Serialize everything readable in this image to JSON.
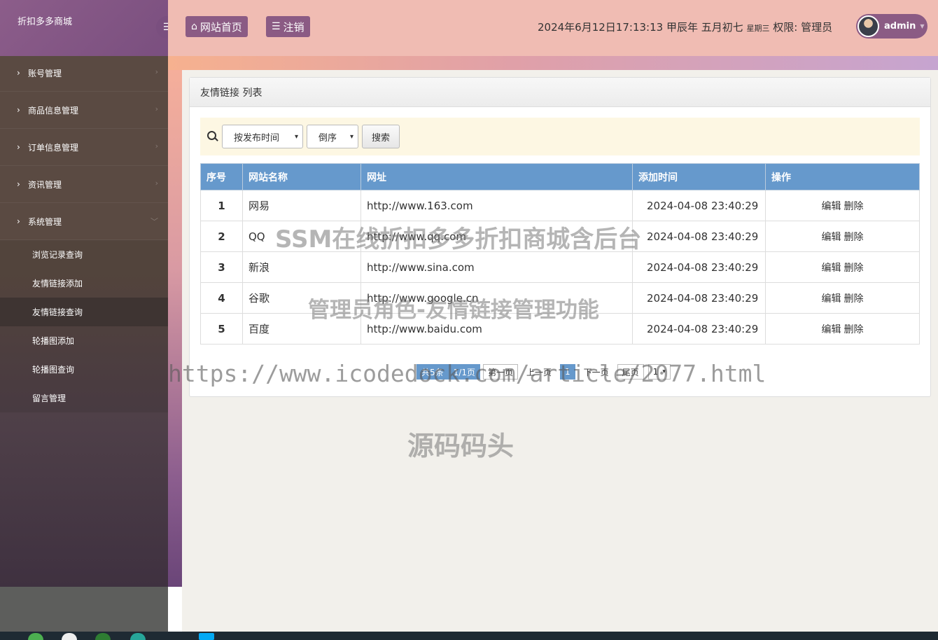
{
  "app": {
    "brand": "折扣多多商城",
    "toggle_icon": "hamburger-icon"
  },
  "header": {
    "home_label": "网站首页",
    "logout_label": "注销",
    "datetime": "2024年6月12日17:13:13 甲辰年 五月初七",
    "weekday": "星期三",
    "role_label": "权限: 管理员",
    "username": "admin"
  },
  "sidebar": {
    "items": [
      {
        "label": "账号管理"
      },
      {
        "label": "商品信息管理"
      },
      {
        "label": "订单信息管理"
      },
      {
        "label": "资讯管理"
      },
      {
        "label": "系统管理"
      }
    ],
    "sub_items": [
      {
        "label": "浏览记录查询"
      },
      {
        "label": "友情链接添加"
      },
      {
        "label": "友情链接查询"
      },
      {
        "label": "轮播图添加"
      },
      {
        "label": "轮播图查询"
      },
      {
        "label": "留言管理"
      }
    ]
  },
  "panel": {
    "title": "友情链接 列表"
  },
  "search": {
    "sort_field": "按发布时间",
    "sort_order": "倒序",
    "button_label": "搜索"
  },
  "table": {
    "headers": [
      "序号",
      "网站名称",
      "网址",
      "添加时间",
      "操作"
    ],
    "rows": [
      {
        "id": "1",
        "name": "网易",
        "url": "http://www.163.com",
        "time": "2024-04-08 23:40:29"
      },
      {
        "id": "2",
        "name": "QQ",
        "url": "http://www.qq.com",
        "time": "2024-04-08 23:40:29"
      },
      {
        "id": "3",
        "name": "新浪",
        "url": "http://www.sina.com",
        "time": "2024-04-08 23:40:29"
      },
      {
        "id": "4",
        "name": "谷歌",
        "url": "http://www.google.cn",
        "time": "2024-04-08 23:40:29"
      },
      {
        "id": "5",
        "name": "百度",
        "url": "http://www.baidu.com",
        "time": "2024-04-08 23:40:29"
      }
    ],
    "edit_label": "编辑",
    "delete_label": "删除"
  },
  "pager": {
    "total": "共5条",
    "pages": "1/1页",
    "first": "第一页",
    "prev": "上一页",
    "current": "1",
    "next": "下一页",
    "last": "尾页",
    "jump_value": "1"
  },
  "watermarks": {
    "line1": "SSM在线折扣多多折扣商城含后台",
    "line2": "管理员角色-友情链接管理功能",
    "line3": "https://www.icodedock.com/article/2077.html",
    "line4": "源码码头"
  },
  "colors": {
    "accent": "#8b5b84",
    "table_header": "#6699cc",
    "header_bg": "#f0bcb3"
  }
}
